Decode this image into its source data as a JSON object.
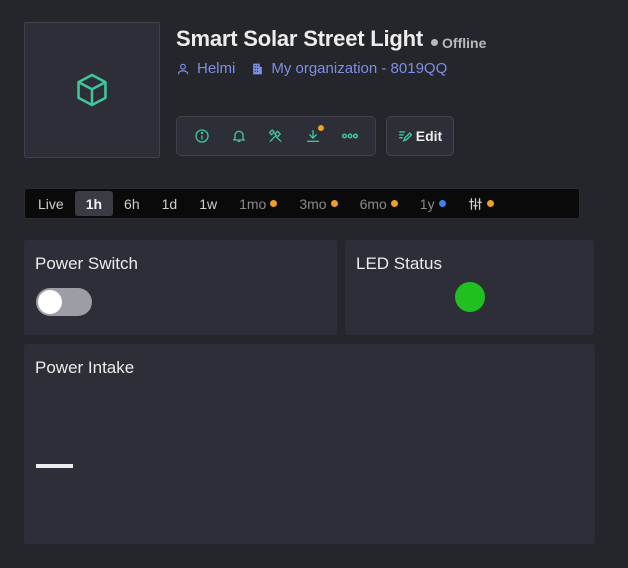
{
  "device": {
    "title": "Smart Solar Street Light",
    "status": "Offline",
    "owner": "Helmi",
    "organization": "My organization - 8019QQ",
    "thumbnail_icon": "cube-icon"
  },
  "colors": {
    "accent": "#3fc79a",
    "link": "#7e8ee6",
    "background": "#25262b",
    "card": "#2d2e37",
    "led_on": "#20c020",
    "badge_orange": "#f0a020",
    "badge_blue": "#3b82f6"
  },
  "toolbar": {
    "actions": [
      "info-icon",
      "bell-icon",
      "tools-icon",
      "download-icon",
      "more-icon"
    ],
    "edit_label": "Edit"
  },
  "time_range": {
    "options": [
      {
        "label": "Live",
        "active": false,
        "badge": null
      },
      {
        "label": "1h",
        "active": true,
        "badge": null
      },
      {
        "label": "6h",
        "active": false,
        "badge": null
      },
      {
        "label": "1d",
        "active": false,
        "badge": null
      },
      {
        "label": "1w",
        "active": false,
        "badge": null
      },
      {
        "label": "1mo",
        "active": false,
        "badge": "orange"
      },
      {
        "label": "3mo",
        "active": false,
        "badge": "orange"
      },
      {
        "label": "6mo",
        "active": false,
        "badge": "orange"
      },
      {
        "label": "1y",
        "active": false,
        "badge": "blue"
      }
    ],
    "settings_icon": "sliders-icon"
  },
  "widgets": {
    "power_switch": {
      "label": "Power Switch",
      "on": false
    },
    "led_status": {
      "label": "LED Status",
      "on": true
    },
    "power_intake": {
      "label": "Power Intake",
      "value": "—"
    }
  }
}
